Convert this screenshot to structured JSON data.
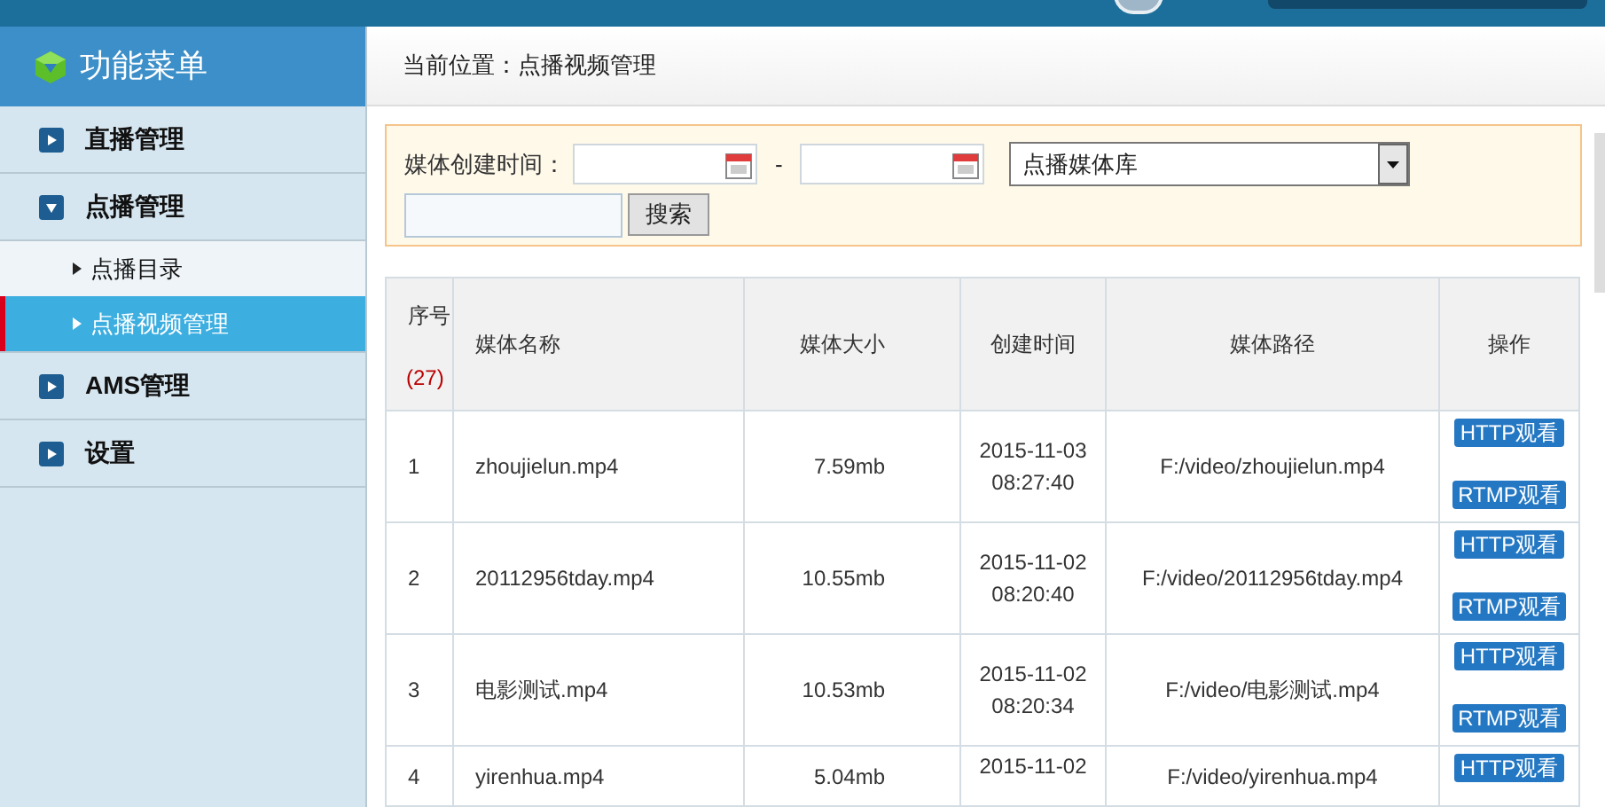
{
  "sidebar": {
    "title": "功能菜单",
    "items": [
      {
        "label": "直播管理",
        "expanded": false
      },
      {
        "label": "点播管理",
        "expanded": true,
        "children": [
          {
            "label": "点播目录",
            "selected": false
          },
          {
            "label": "点播视频管理",
            "selected": true
          }
        ]
      },
      {
        "label": "AMS管理",
        "expanded": false
      },
      {
        "label": "设置",
        "expanded": false
      }
    ]
  },
  "breadcrumb": "当前位置：点播视频管理",
  "filter": {
    "date_label": "媒体创建时间：",
    "separator": "-",
    "library": "点播媒体库",
    "search_button": "搜索"
  },
  "table": {
    "columns": [
      "序号",
      "媒体名称",
      "媒体大小",
      "创建时间",
      "媒体路径",
      "操作"
    ],
    "count": "(27)",
    "rows": [
      {
        "index": "1",
        "name": "zhoujielun.mp4",
        "size": "7.59mb",
        "date": "2015-11-03",
        "time": "08:27:40",
        "path": "F:/video/zhoujielun.mp4",
        "actions": [
          "HTTP观看",
          "RTMP观看"
        ]
      },
      {
        "index": "2",
        "name": "20112956tday.mp4",
        "size": "10.55mb",
        "date": "2015-11-02",
        "time": "08:20:40",
        "path": "F:/video/20112956tday.mp4",
        "actions": [
          "HTTP观看",
          "RTMP观看"
        ]
      },
      {
        "index": "3",
        "name": "电影测试.mp4",
        "size": "10.53mb",
        "date": "2015-11-02",
        "time": "08:20:34",
        "path": "F:/video/电影测试.mp4",
        "actions": [
          "HTTP观看",
          "RTMP观看"
        ]
      },
      {
        "index": "4",
        "name": "yirenhua.mp4",
        "size": "5.04mb",
        "date": "2015-11-02",
        "path": "F:/video/yirenhua.mp4",
        "actions": [
          "HTTP观看"
        ]
      }
    ]
  }
}
